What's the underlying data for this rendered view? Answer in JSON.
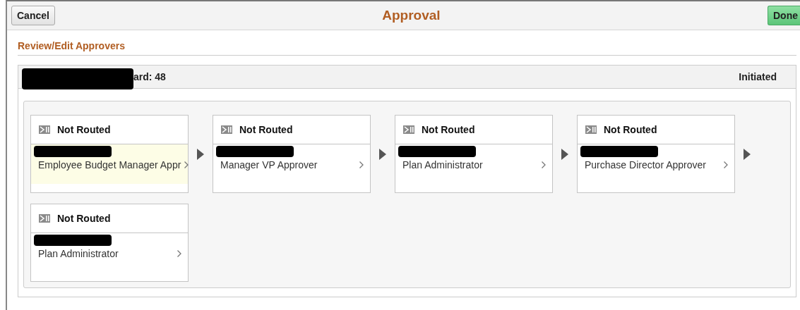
{
  "toolbar": {
    "cancel": "Cancel",
    "title": "Approval",
    "done": "Done"
  },
  "section_title": "Review/Edit Approvers",
  "header": {
    "label": "ard: 48",
    "status": "Initiated"
  },
  "steps": [
    {
      "status": "Not Routed",
      "role": "Employee Budget Manager Appr",
      "selected": true
    },
    {
      "status": "Not Routed",
      "role": "Manager VP Approver",
      "selected": false
    },
    {
      "status": "Not Routed",
      "role": "Plan Administrator",
      "selected": false
    },
    {
      "status": "Not Routed",
      "role": "Purchase Director Approver",
      "selected": false
    },
    {
      "status": "Not Routed",
      "role": "Plan Administrator",
      "selected": false
    }
  ]
}
